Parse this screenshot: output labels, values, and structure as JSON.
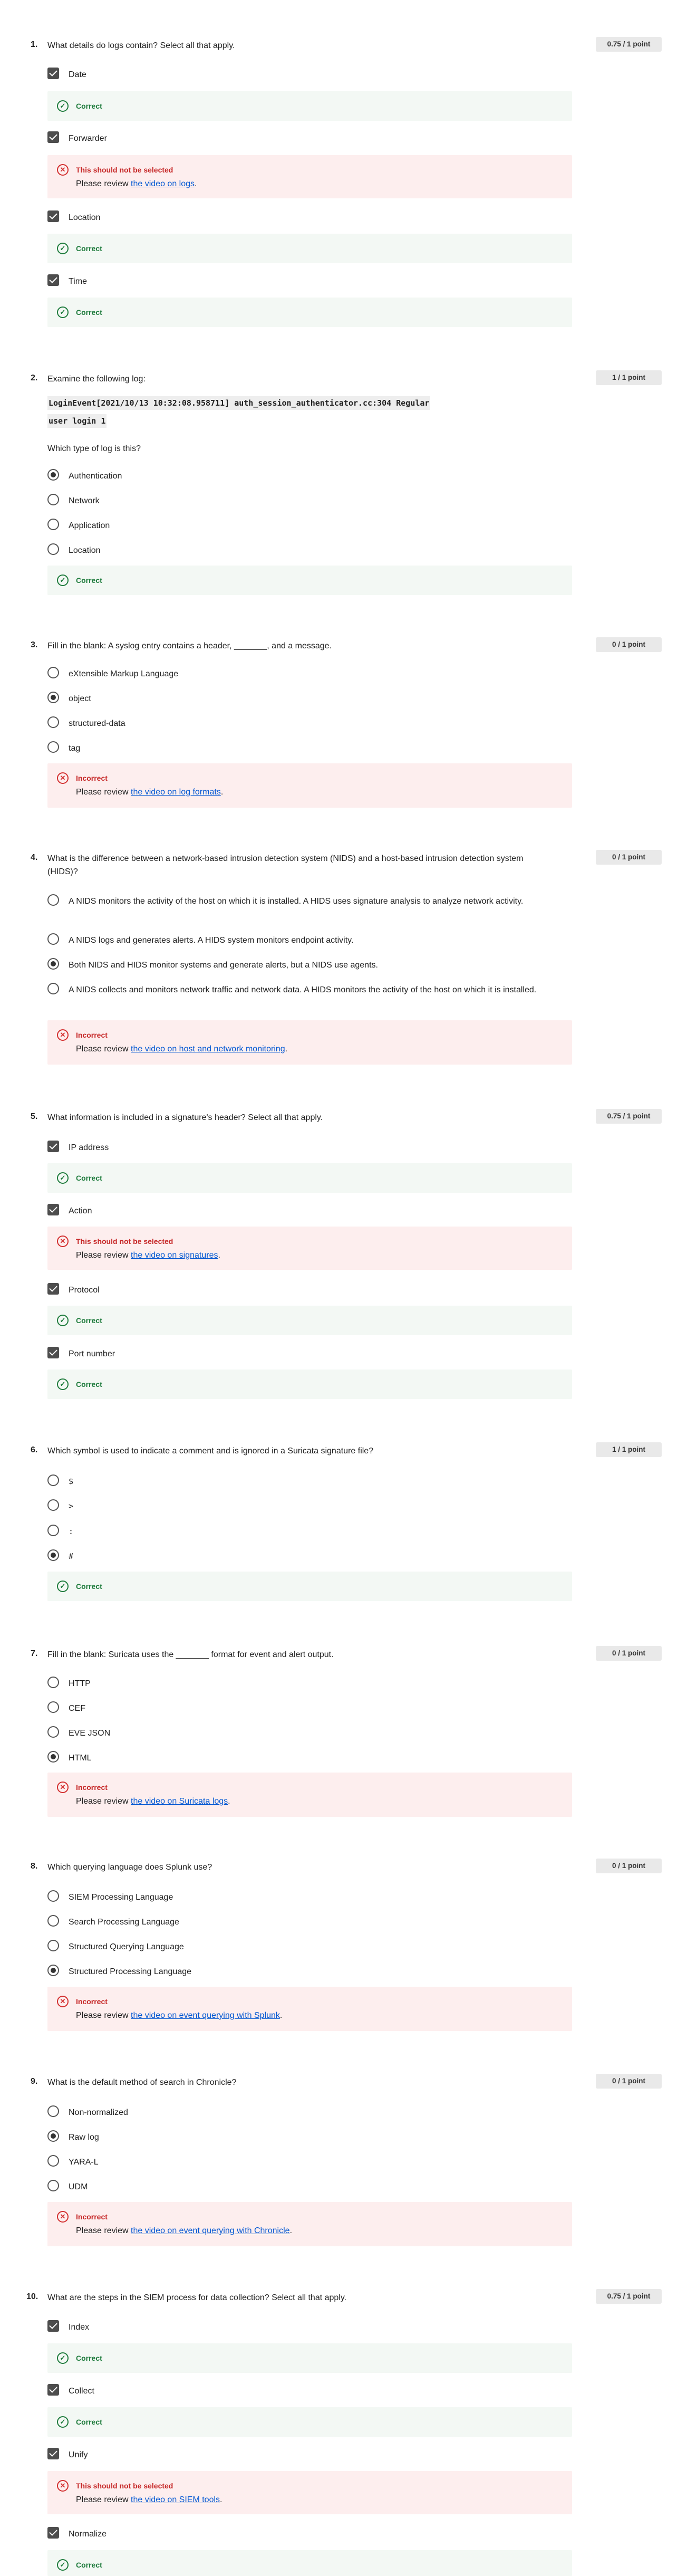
{
  "questions": [
    {
      "number": "1.",
      "prompt": "What details do logs contain? Select all that apply.",
      "score": "0.75 / 1 point",
      "options": [
        {
          "label": "Date",
          "selected": true,
          "feedback": {
            "status": "Correct"
          }
        },
        {
          "label": "Forwarder",
          "selected": true,
          "feedback": {
            "status": "This should not be selected",
            "pre": "Please review ",
            "link": "the video on logs",
            "post": "."
          }
        },
        {
          "label": "Location",
          "selected": true,
          "feedback": {
            "status": "Correct"
          }
        },
        {
          "label": "Time",
          "selected": true,
          "feedback": {
            "status": "Correct"
          }
        }
      ]
    },
    {
      "number": "2.",
      "prompt": "Examine the following log:",
      "code_line1": "LoginEvent[2021/10/13 10:32:08.958711] auth_session_authenticator.cc:304 Regular",
      "code_line2": "user login 1",
      "subprompt": "Which type of log is this?",
      "score": "1 / 1 point",
      "options": [
        "Authentication",
        "Network",
        "Application",
        "Location"
      ],
      "selected_index": 0,
      "feedback": {
        "status": "Correct"
      }
    },
    {
      "number": "3.",
      "prompt": "Fill in the blank: A syslog entry contains a header, _______, and a message.",
      "score": "0 / 1 point",
      "options": [
        "eXtensible Markup Language",
        "object",
        "structured-data",
        "tag"
      ],
      "selected_index": 1,
      "feedback": {
        "status": "Incorrect",
        "pre": "Please review ",
        "link": "the video on log formats",
        "post": "."
      }
    },
    {
      "number": "4.",
      "prompt": "What is the difference between a network-based intrusion detection system (NIDS) and a host-based intrusion detection system (HIDS)?",
      "score": "0 / 1 point",
      "options": [
        "A NIDS monitors the activity of the host on which it is installed. A HIDS uses signature analysis to analyze network activity.",
        "A NIDS logs and generates alerts. A HIDS system monitors endpoint activity.",
        "Both NIDS and HIDS monitor systems and generate alerts, but a NIDS use agents.",
        "A NIDS collects and monitors network traffic and network data. A HIDS monitors the activity of the host on which it is installed."
      ],
      "selected_index": 2,
      "feedback": {
        "status": "Incorrect",
        "pre": "Please review ",
        "link": "the video on host and network monitoring",
        "post": "."
      }
    },
    {
      "number": "5.",
      "prompt": "What information is included in a signature's header? Select all that apply.",
      "score": "0.75 / 1 point",
      "options": [
        {
          "label": "IP address",
          "selected": true,
          "feedback": {
            "status": "Correct"
          }
        },
        {
          "label": "Action",
          "selected": true,
          "feedback": {
            "status": "This should not be selected",
            "pre": "Please review ",
            "link": "the video on signatures",
            "post": "."
          }
        },
        {
          "label": "Protocol",
          "selected": true,
          "feedback": {
            "status": "Correct"
          }
        },
        {
          "label": "Port number",
          "selected": true,
          "feedback": {
            "status": "Correct"
          }
        }
      ]
    },
    {
      "number": "6.",
      "prompt": "Which symbol is used to indicate a comment and is ignored in a Suricata signature file?",
      "score": "1 / 1 point",
      "options": [
        "$",
        ">",
        ":",
        "#"
      ],
      "selected_index": 3,
      "feedback": {
        "status": "Correct"
      }
    },
    {
      "number": "7.",
      "prompt": "Fill in the blank: Suricata uses the _______ format for event and alert output.",
      "score": "0 / 1 point",
      "options": [
        "HTTP",
        "CEF",
        "EVE JSON",
        "HTML"
      ],
      "selected_index": 3,
      "feedback": {
        "status": "Incorrect",
        "pre": "Please review ",
        "link": "the video on Suricata logs",
        "post": "."
      }
    },
    {
      "number": "8.",
      "prompt": "Which querying language does Splunk use?",
      "score": "0 / 1 point",
      "options": [
        "SIEM Processing Language",
        "Search Processing Language",
        "Structured Querying Language",
        "Structured Processing Language"
      ],
      "selected_index": 3,
      "feedback": {
        "status": "Incorrect",
        "pre": "Please review ",
        "link": "the video on event querying with Splunk",
        "post": "."
      }
    },
    {
      "number": "9.",
      "prompt": "What is the default method of search in Chronicle?",
      "score": "0 / 1 point",
      "options": [
        "Non-normalized",
        "Raw log",
        "YARA-L",
        "UDM"
      ],
      "selected_index": 1,
      "feedback": {
        "status": "Incorrect",
        "pre": "Please review ",
        "link": "the video on event querying with Chronicle",
        "post": "."
      }
    },
    {
      "number": "10.",
      "prompt": "What are the steps in the SIEM process for data collection? Select all that apply.",
      "score": "0.75 / 1 point",
      "options": [
        {
          "label": "Index",
          "selected": true,
          "feedback": {
            "status": "Correct"
          }
        },
        {
          "label": "Collect",
          "selected": true,
          "feedback": {
            "status": "Correct"
          }
        },
        {
          "label": "Unify",
          "selected": true,
          "feedback": {
            "status": "This should not be selected",
            "pre": "Please review ",
            "link": "the video on SIEM tools",
            "post": "."
          }
        },
        {
          "label": "Normalize",
          "selected": true,
          "feedback": {
            "status": "Correct"
          }
        }
      ]
    }
  ],
  "icons": {
    "correct": "check-circle-icon",
    "incorrect": "x-circle-icon"
  },
  "colors": {
    "correct": "#1e7b3c",
    "incorrect": "#c62828",
    "link": "#0056d2",
    "correct_bg": "#f3f8f4",
    "incorrect_bg": "#fdeeee"
  }
}
